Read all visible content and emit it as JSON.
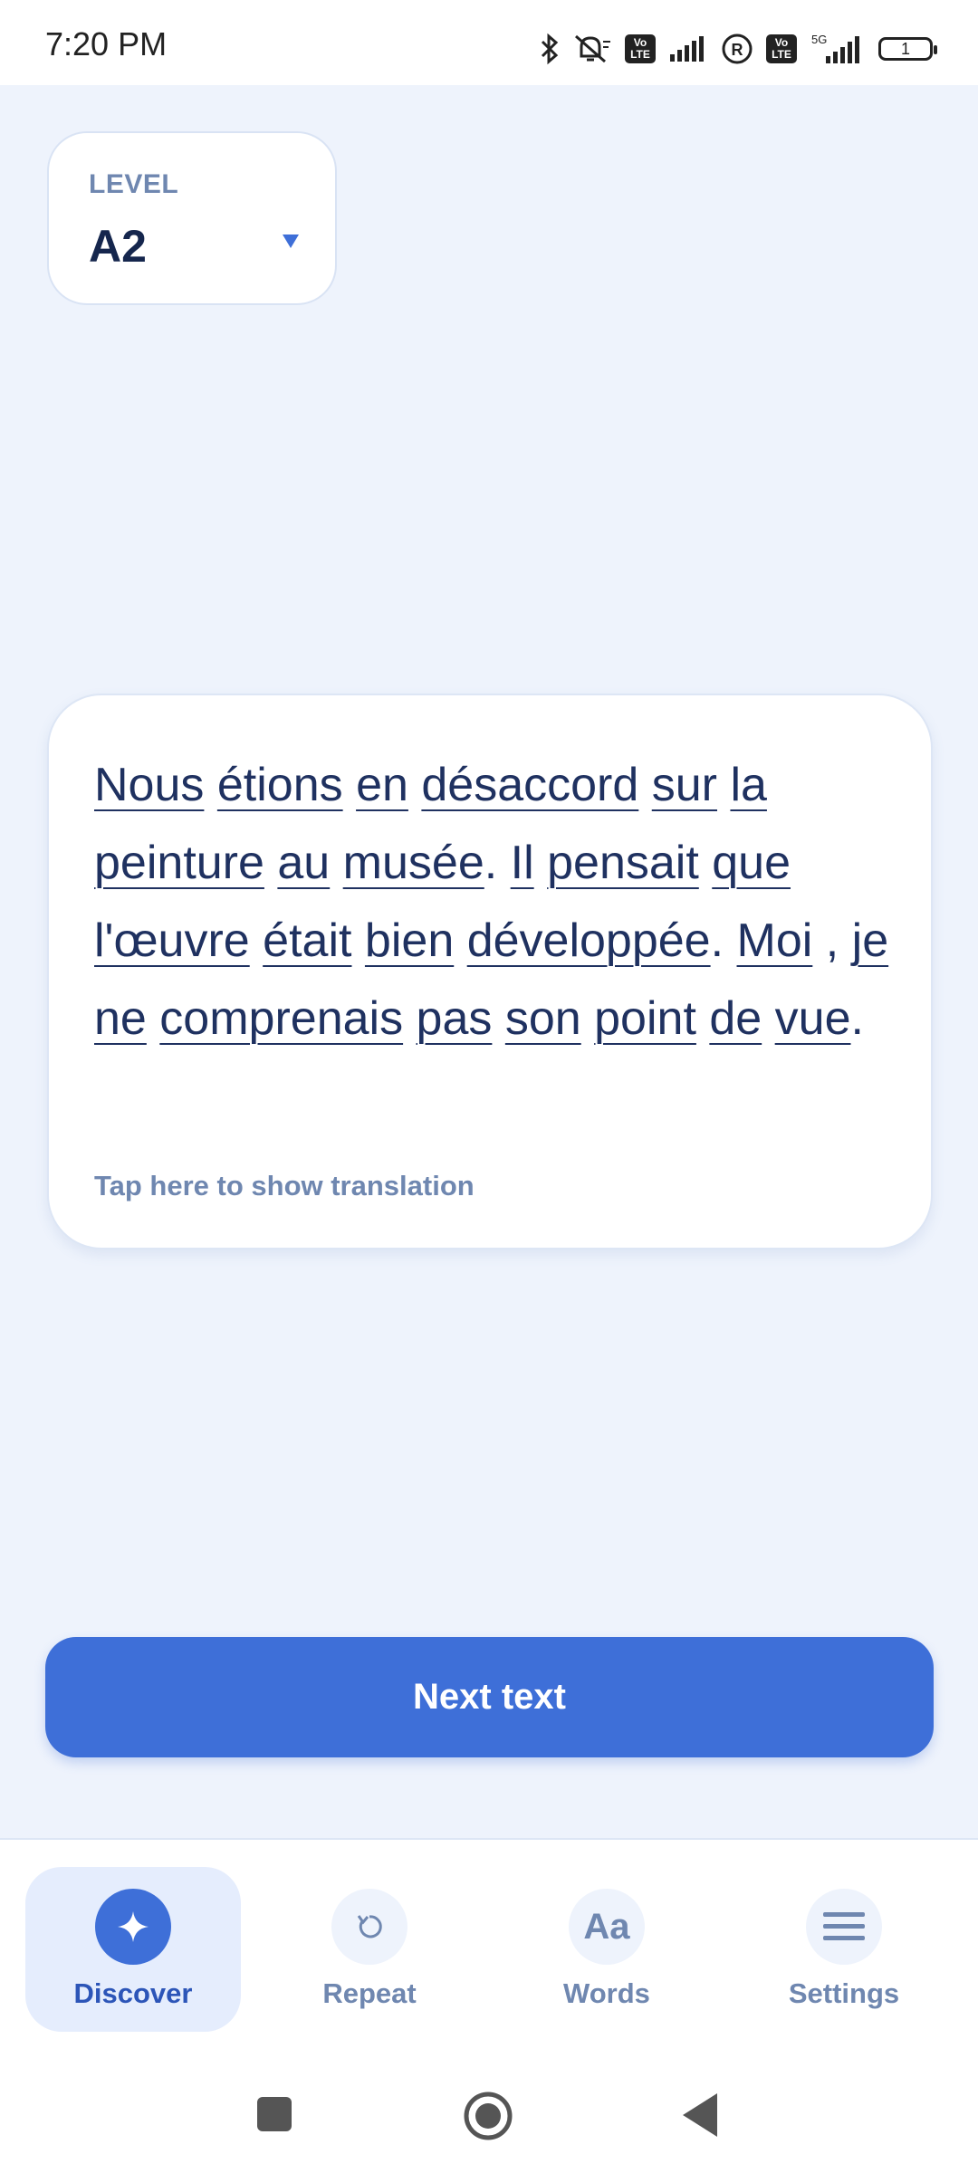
{
  "status_bar": {
    "time": "7:20 PM",
    "battery": "1",
    "network": "5G",
    "volte": "Vo LTE"
  },
  "level": {
    "label": "LEVEL",
    "value": "A2"
  },
  "text_card": {
    "sentence_tokens": [
      {
        "text": "Nous",
        "word": true
      },
      {
        "text": " "
      },
      {
        "text": "étions",
        "word": true
      },
      {
        "text": " "
      },
      {
        "text": "en",
        "word": true
      },
      {
        "text": " "
      },
      {
        "text": "désaccord",
        "word": true
      },
      {
        "text": " "
      },
      {
        "text": "sur",
        "word": true
      },
      {
        "text": " "
      },
      {
        "text": "la",
        "word": true
      },
      {
        "text": " "
      },
      {
        "text": "peinture",
        "word": true
      },
      {
        "text": " "
      },
      {
        "text": "au",
        "word": true
      },
      {
        "text": " "
      },
      {
        "text": "musée",
        "word": true
      },
      {
        "text": ". "
      },
      {
        "text": "Il",
        "word": true
      },
      {
        "text": " "
      },
      {
        "text": "pensait",
        "word": true
      },
      {
        "text": " "
      },
      {
        "text": "que",
        "word": true
      },
      {
        "text": " "
      },
      {
        "text": "l'œuvre",
        "word": true
      },
      {
        "text": " "
      },
      {
        "text": "était",
        "word": true
      },
      {
        "text": " "
      },
      {
        "text": "bien",
        "word": true
      },
      {
        "text": " "
      },
      {
        "text": "développée",
        "word": true
      },
      {
        "text": ". "
      },
      {
        "text": "Moi",
        "word": true
      },
      {
        "text": " , "
      },
      {
        "text": "je",
        "word": true
      },
      {
        "text": " "
      },
      {
        "text": "ne",
        "word": true
      },
      {
        "text": " "
      },
      {
        "text": "comprenais",
        "word": true
      },
      {
        "text": " "
      },
      {
        "text": "pas",
        "word": true
      },
      {
        "text": " "
      },
      {
        "text": "son",
        "word": true
      },
      {
        "text": " "
      },
      {
        "text": "point",
        "word": true
      },
      {
        "text": " "
      },
      {
        "text": "de",
        "word": true
      },
      {
        "text": " "
      },
      {
        "text": "vue",
        "word": true
      },
      {
        "text": "."
      }
    ],
    "translation_hint": "Tap here to show translation"
  },
  "next_button": {
    "label": "Next text"
  },
  "bottom_nav": {
    "items": [
      {
        "label": "Discover",
        "icon": "sparkle-icon",
        "active": true
      },
      {
        "label": "Repeat",
        "icon": "repeat-icon",
        "active": false
      },
      {
        "label": "Words",
        "icon": "words-icon",
        "icon_text": "Aa",
        "active": false
      },
      {
        "label": "Settings",
        "icon": "menu-icon",
        "active": false
      }
    ]
  },
  "colors": {
    "accent": "#3e6fd8",
    "background": "#eef3fc",
    "text_dark": "#1f3160",
    "muted": "#6f87b0"
  }
}
